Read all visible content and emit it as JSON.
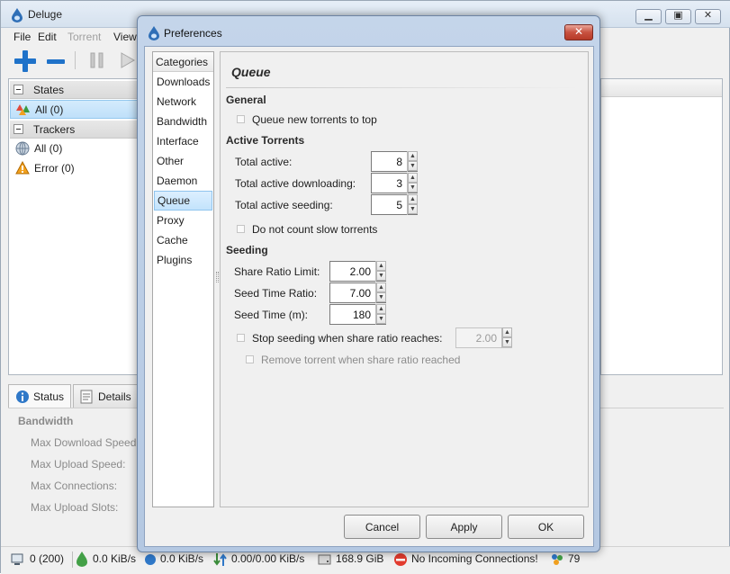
{
  "main": {
    "title": "Deluge",
    "menu": [
      "File",
      "Edit",
      "Torrent",
      "View"
    ],
    "window_controls": [
      "minimize",
      "maximize",
      "close"
    ],
    "toolbar_icons": [
      "add-icon",
      "remove-icon",
      "pause-icon",
      "resume-icon"
    ]
  },
  "sidebar": {
    "states_header": "States",
    "states_items": [
      {
        "label": "All (0)",
        "icon": "all-states-icon",
        "selected": true
      }
    ],
    "trackers_header": "Trackers",
    "trackers_items": [
      {
        "label": "All (0)",
        "icon": "globe-icon"
      },
      {
        "label": "Error (0)",
        "icon": "warning-icon"
      }
    ]
  },
  "bottom": {
    "tabs": [
      "Status",
      "Details"
    ],
    "bandwidth_header": "Bandwidth",
    "fields": [
      "Max Download Speed",
      "Max Upload Speed:",
      "Max Connections:",
      "Max Upload Slots:"
    ]
  },
  "statusbar": {
    "connections": "0 (200)",
    "download": "0.0 KiB/s",
    "upload": "0.0 KiB/s",
    "protocol": "0.00/0.00 KiB/s",
    "disk": "168.9 GiB",
    "incoming": "No Incoming Connections!",
    "dht": "79"
  },
  "dialog": {
    "title": "Preferences",
    "categories_header": "Categories",
    "categories": [
      "Downloads",
      "Network",
      "Bandwidth",
      "Interface",
      "Other",
      "Daemon",
      "Queue",
      "Proxy",
      "Cache",
      "Plugins"
    ],
    "selected_category": "Queue",
    "page_title": "Queue",
    "general": {
      "header": "General",
      "queue_new_to_top": "Queue new torrents to top"
    },
    "active": {
      "header": "Active Torrents",
      "total_active_label": "Total active:",
      "total_active": "8",
      "total_downloading_label": "Total active downloading:",
      "total_downloading": "3",
      "total_seeding_label": "Total active seeding:",
      "total_seeding": "5",
      "slow_torrents": "Do not count slow torrents"
    },
    "seeding": {
      "header": "Seeding",
      "share_ratio_label": "Share Ratio Limit:",
      "share_ratio": "2.00",
      "seed_time_ratio_label": "Seed Time Ratio:",
      "seed_time_ratio": "7.00",
      "seed_time_label": "Seed Time (m):",
      "seed_time": "180",
      "stop_seeding": "Stop seeding when share ratio reaches:",
      "stop_ratio": "2.00",
      "remove_torrent": "Remove torrent when share ratio reached"
    },
    "buttons": {
      "cancel": "Cancel",
      "apply": "Apply",
      "ok": "OK"
    }
  },
  "colors": {
    "accent": "#1f72c9",
    "selection": "#c3e3fc",
    "dialog_frame": "#b4c8e2",
    "close_button": "#c8513f"
  }
}
